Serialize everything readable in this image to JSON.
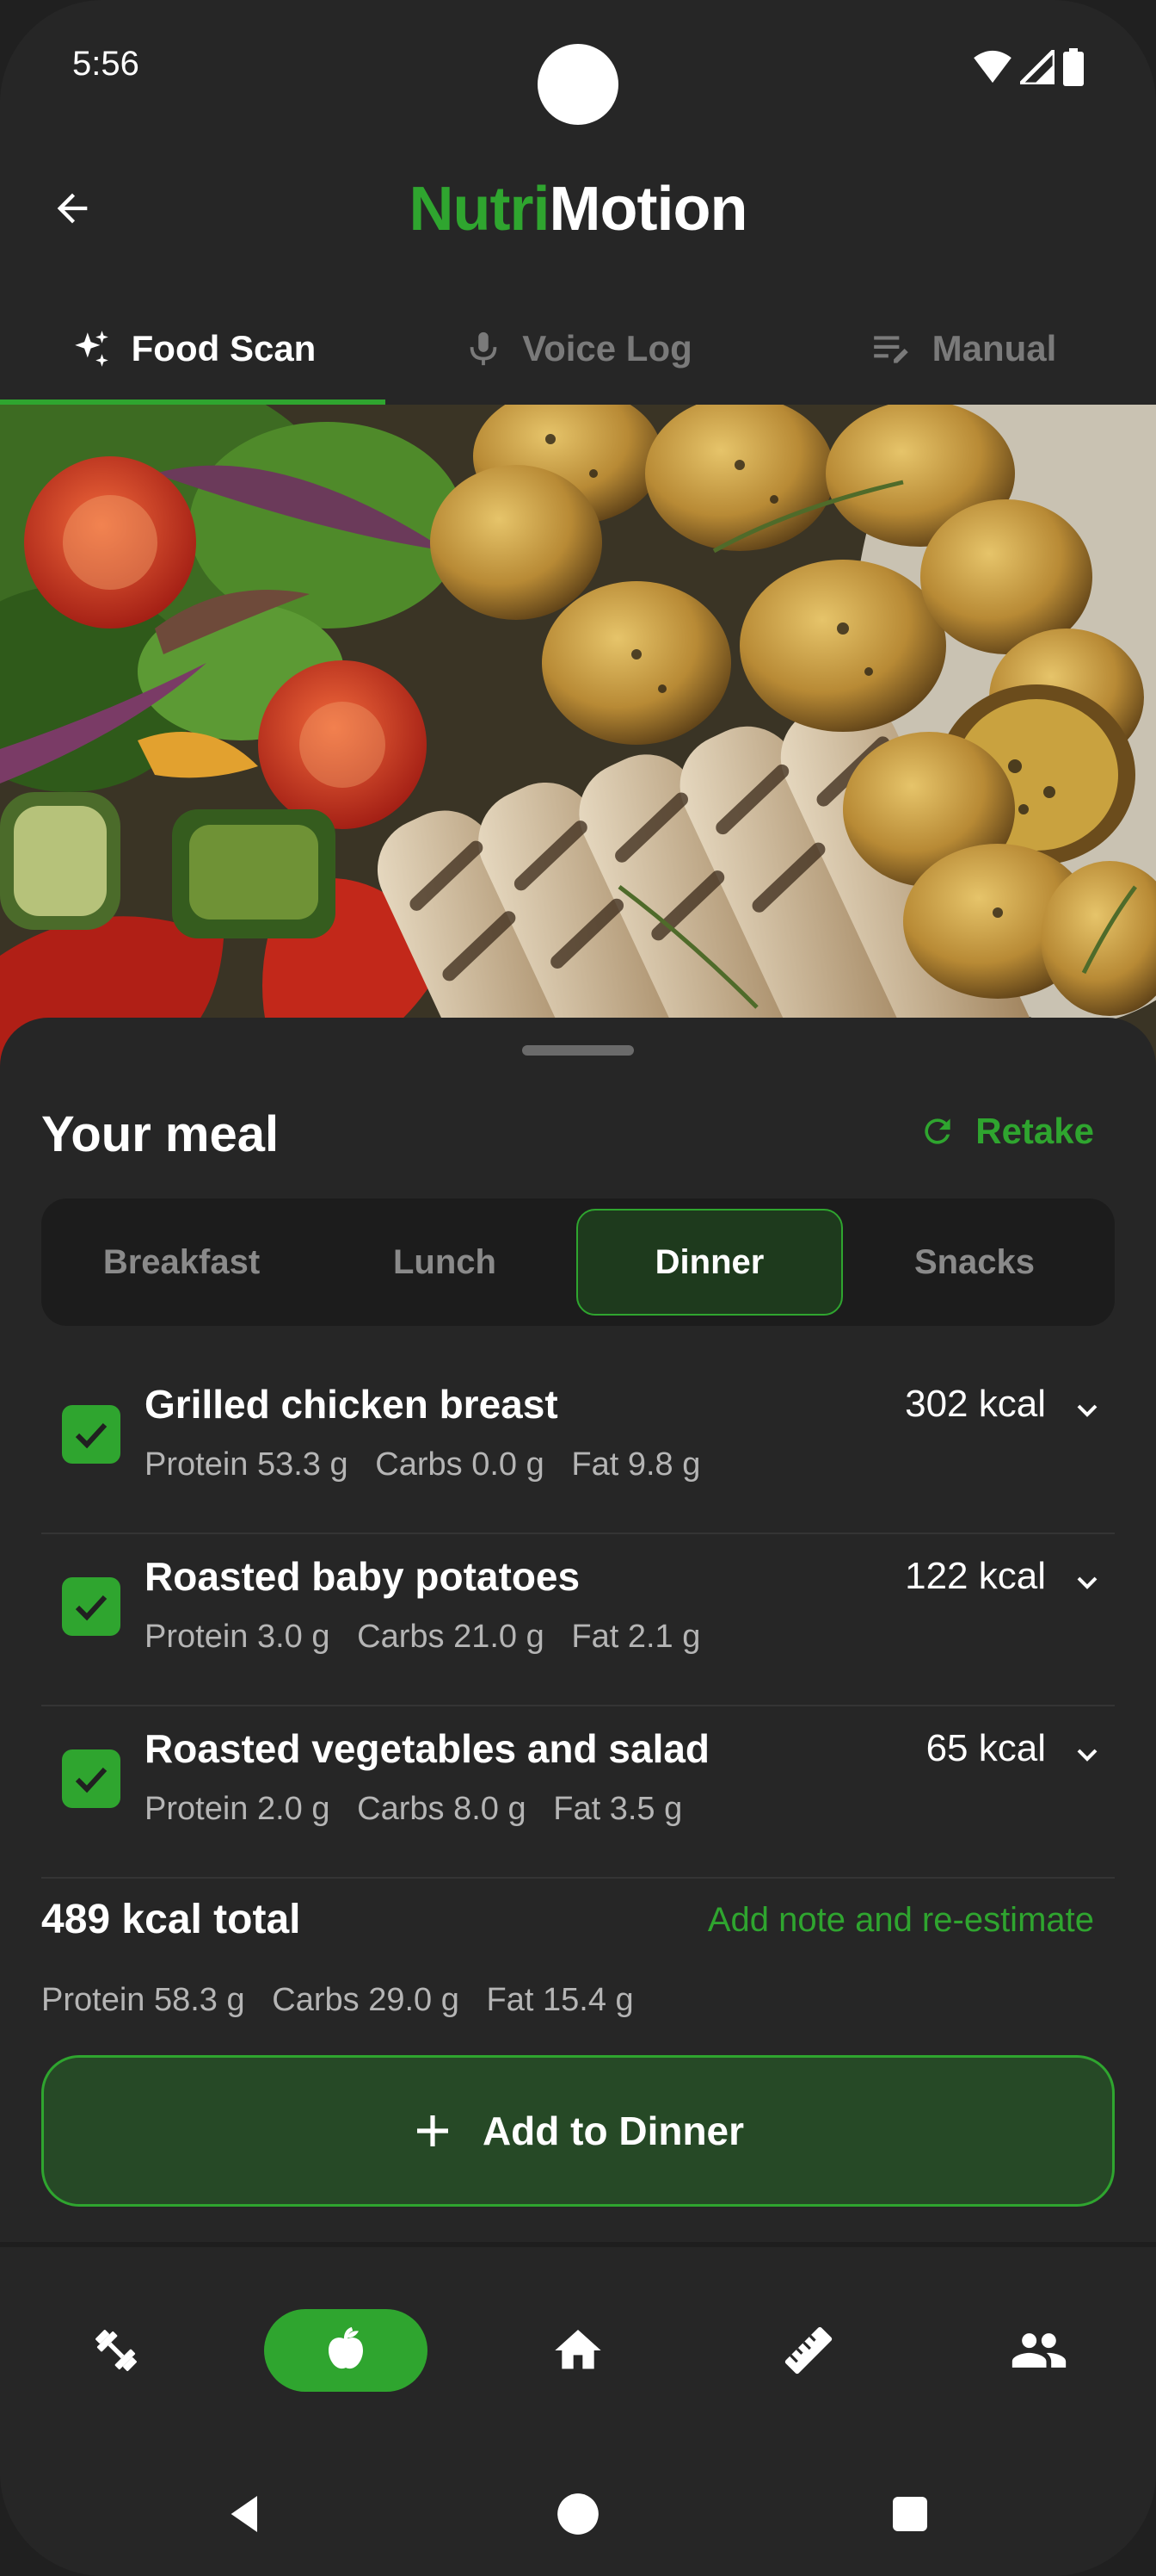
{
  "status_bar": {
    "time": "5:56"
  },
  "app_bar": {
    "title_part1": "Nutri",
    "title_part2": "Motion",
    "brand_color": "#2fa52f"
  },
  "tabs": [
    {
      "label": "Food Scan",
      "icon": "sparkle-icon",
      "active": true
    },
    {
      "label": "Voice Log",
      "icon": "microphone-icon",
      "active": false
    },
    {
      "label": "Manual",
      "icon": "edit-list-icon",
      "active": false
    }
  ],
  "sheet": {
    "title": "Your meal",
    "retake_label": "Retake",
    "meal_types": [
      {
        "label": "Breakfast",
        "active": false
      },
      {
        "label": "Lunch",
        "active": false
      },
      {
        "label": "Dinner",
        "active": true
      },
      {
        "label": "Snacks",
        "active": false
      }
    ],
    "foods": [
      {
        "name": "Grilled chicken breast",
        "kcal": "302 kcal",
        "macros": "Protein 53.3 g   Carbs 0.0 g   Fat 9.8 g",
        "checked": true
      },
      {
        "name": "Roasted baby potatoes",
        "kcal": "122 kcal",
        "macros": "Protein 3.0 g   Carbs 21.0 g   Fat 2.1 g",
        "checked": true
      },
      {
        "name": "Roasted vegetables and salad",
        "kcal": "65 kcal",
        "macros": "Protein 2.0 g   Carbs 8.0 g   Fat 3.5 g",
        "checked": true
      }
    ],
    "total_kcal": "489 kcal total",
    "add_note_label": "Add note and re-estimate",
    "total_macros": "Protein 58.3 g   Carbs 29.0 g   Fat 15.4 g",
    "add_button_label": "Add to Dinner"
  },
  "bottom_nav": [
    {
      "icon": "dumbbell-icon",
      "active": false
    },
    {
      "icon": "apple-icon",
      "active": true
    },
    {
      "icon": "home-icon",
      "active": false
    },
    {
      "icon": "ruler-icon",
      "active": false
    },
    {
      "icon": "people-icon",
      "active": false
    }
  ]
}
